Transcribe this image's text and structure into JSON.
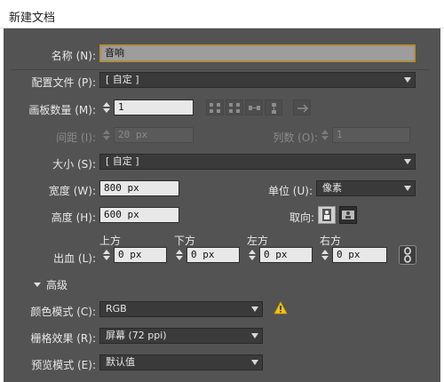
{
  "window": {
    "title": "新建文档"
  },
  "name": {
    "label": "名称 (N):",
    "value": "音响"
  },
  "profile": {
    "label": "配置文件 (P):",
    "value": "[ 自定 ]"
  },
  "artboards": {
    "count_label": "画板数量 (M):",
    "count_value": "1",
    "spacing_label": "间距 (I):",
    "spacing_value": "20 px",
    "columns_label": "列数 (O):",
    "columns_value": "1"
  },
  "size": {
    "label": "大小 (S):",
    "value": "[ 自定 ]"
  },
  "width": {
    "label": "宽度 (W):",
    "value": "800 px"
  },
  "units": {
    "label": "单位 (U):",
    "value": "像素"
  },
  "height": {
    "label": "高度 (H):",
    "value": "600 px"
  },
  "orientation": {
    "label": "取向:"
  },
  "bleed": {
    "label": "出血 (L):",
    "top_label": "上方",
    "top_value": "0 px",
    "bottom_label": "下方",
    "bottom_value": "0 px",
    "left_label": "左方",
    "left_value": "0 px",
    "right_label": "右方",
    "right_value": "0 px"
  },
  "advanced": {
    "label": "高级"
  },
  "color_mode": {
    "label": "颜色模式 (C):",
    "value": "RGB"
  },
  "raster": {
    "label": "栅格效果 (R):",
    "value": "屏幕 (72 ppi)"
  },
  "preview": {
    "label": "预览模式 (E):",
    "value": "默认值"
  },
  "colors": {
    "panel": "#535353",
    "focus_border": "#b18d3f",
    "warning": "#f0c419"
  }
}
